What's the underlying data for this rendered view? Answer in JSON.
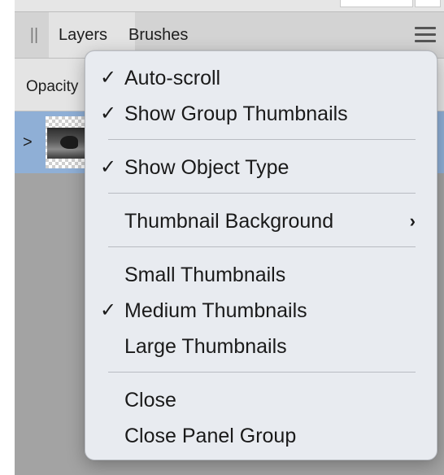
{
  "tabs": {
    "grip": "||",
    "layers": "Layers",
    "brushes": "Brushes"
  },
  "opacity": {
    "label": "Opacity"
  },
  "layer_row": {
    "expander": ">"
  },
  "menu": {
    "items": [
      {
        "label": "Auto-scroll",
        "checked": true,
        "check": "✓"
      },
      {
        "label": "Show Group Thumbnails",
        "checked": true,
        "check": "✓"
      },
      {
        "label": "Show Object Type",
        "checked": true,
        "check": "✓"
      },
      {
        "label": "Thumbnail Background",
        "checked": false,
        "check": "",
        "submenu": "›"
      },
      {
        "label": "Small Thumbnails",
        "checked": false,
        "check": ""
      },
      {
        "label": "Medium Thumbnails",
        "checked": true,
        "check": "✓"
      },
      {
        "label": "Large Thumbnails",
        "checked": false,
        "check": ""
      },
      {
        "label": "Close",
        "checked": false,
        "check": ""
      },
      {
        "label": "Close Panel Group",
        "checked": false,
        "check": ""
      }
    ]
  },
  "colors": {
    "selected_row": "#8fafd6",
    "menu_background": "#e8ebf0",
    "panel_background": "#a3a3a3"
  }
}
